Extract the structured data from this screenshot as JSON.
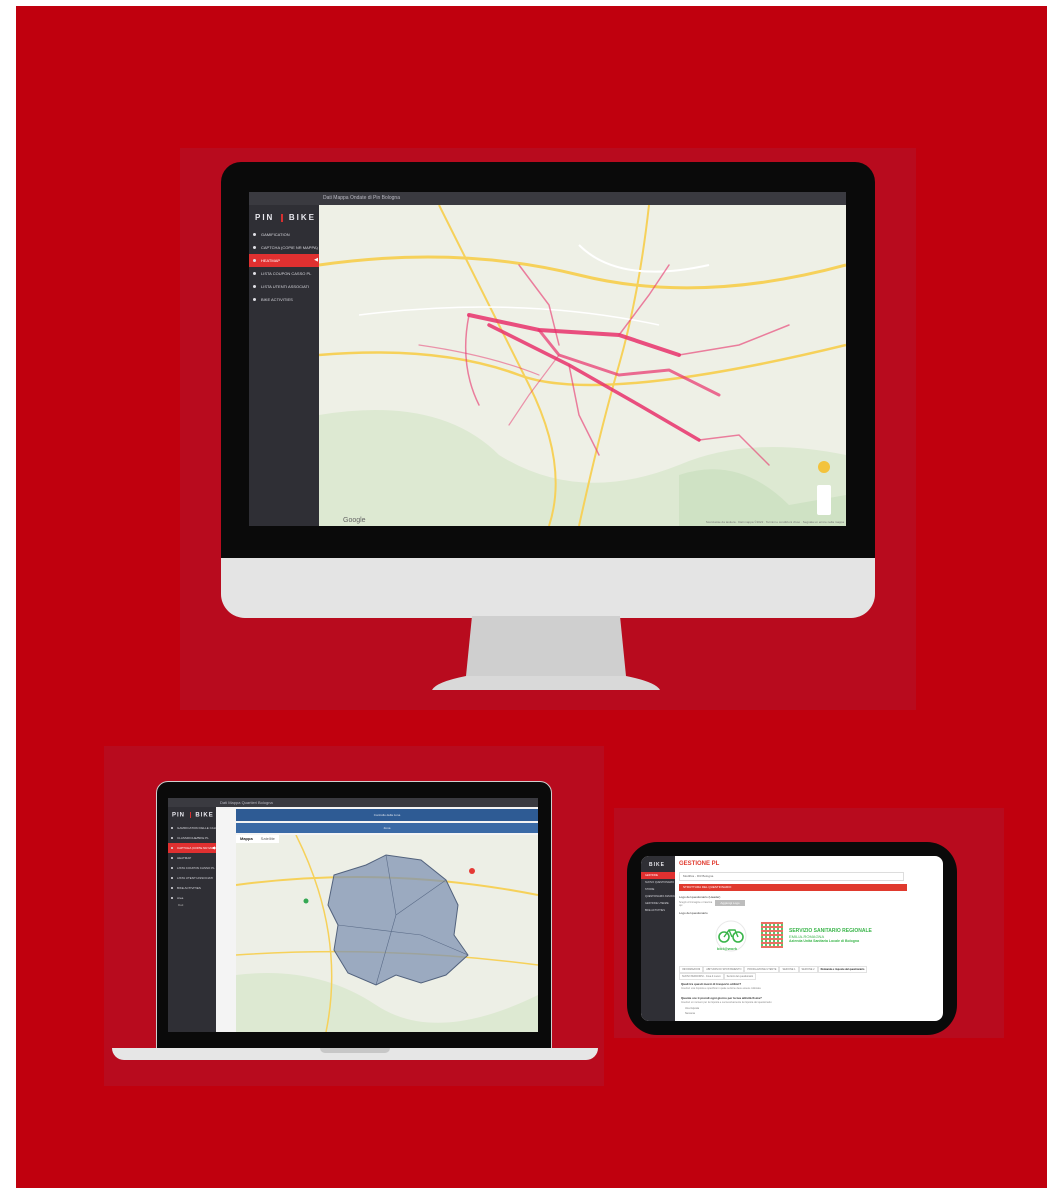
{
  "desktop": {
    "header": "Dati Mappa Ondate di Pin Bologna",
    "logo": {
      "left": "PIN",
      "right": "BIKE"
    },
    "menu": [
      {
        "label": "GAMIFICATION",
        "active": false
      },
      {
        "label": "CAPTCHA (COPIE NR MAPPA)",
        "active": false
      },
      {
        "label": "HEATMAP",
        "active": true
      },
      {
        "label": "LISTA COUPON CASSO PL",
        "active": false
      },
      {
        "label": "LISTA UTENTI ASSOCIATI",
        "active": false
      },
      {
        "label": "BIKE ACTIVITIES",
        "active": false
      }
    ],
    "map": {
      "brand": "Google",
      "attribution": "Scorciatoie da tastiera · Dati mappa ©2022 · Termini e condizioni d'uso · Segnala un errore nella mappa"
    },
    "colors": {
      "route": "#e8316b",
      "active_menu": "#e03030"
    }
  },
  "laptop": {
    "header": "Dati Mappa Quartieri Bologna",
    "logo": {
      "left": "PIN",
      "right": "BIKE"
    },
    "menu": [
      {
        "label": "GAMIFICATION DELLE CALPS",
        "active": false
      },
      {
        "label": "CLASSIFICHE/BIKE PL",
        "active": false
      },
      {
        "label": "CAPTCHA (COPIE NR MAPPA)",
        "active": true
      },
      {
        "label": "HEATMAP",
        "active": false
      },
      {
        "label": "LISTA COUPON CASSO PL",
        "active": false
      },
      {
        "label": "LISTA UTENTI ASSOCIATI",
        "active": false
      },
      {
        "label": "BIKE ACTIVITIES",
        "active": false
      },
      {
        "label": "Area",
        "active": false
      }
    ],
    "menu_sub": "Dati",
    "bar1": "Controllo della zona",
    "bar2": "Zona",
    "tabs": [
      "Mappa",
      "Satellite"
    ],
    "colors": {
      "region_fill": "#7f93b3",
      "bar": "#2e5b94"
    }
  },
  "tablet": {
    "logo": "BIKE",
    "page_title": "GESTIONE PL",
    "menu": [
      {
        "label": "GESTIONE",
        "active": true
      },
      {
        "label": "NUOVO QUESTIONARIO",
        "active": false
      },
      {
        "label": "STORIE",
        "active": false
      },
      {
        "label": "QUESTIONARIO ASSOCIATO",
        "active": false
      },
      {
        "label": "GESTIONE UTENZE",
        "active": false
      },
      {
        "label": "BIKE ACTIVITIES",
        "active": false
      }
    ],
    "select_value": "Modifica - ID3 Bologna",
    "red_bar": "STRUTTURA DEL QUESTIONARIO",
    "field1_label": "Logo del questionario (Header)",
    "field1_hint": "Scegli un'immagine o trascina qui",
    "upload_button": "Aggiungi Logo",
    "field2_label": "Logo del questionario",
    "logo_bike_text": "bici@work",
    "logo_text": [
      "SERVIZIO SANITARIO REGIONALE",
      "EMILIA-ROMAGNA",
      "Azienda Unità Sanitaria Locale di Bologna"
    ],
    "tabs": [
      "INFORMAZIONI",
      "ABITUDINI DI SPOSTAMENTO",
      "PROFILAZIONE UTENTE",
      "SEZIONE 1",
      "SEZIONE 2",
      "Domande e risposte del questionario",
      "NUOVI PERCORSI - Crea il nuovo",
      "Sezioni del questionario"
    ],
    "q1_title": "Quali tra questi mezzi di trasporto utilizzi?",
    "q1_hint": "Inserisci una risposta e specifica in quale sezione deve essere collocata",
    "q2_title": "Quante ore ti prendi ogni giorno per la tua attività fisica?",
    "q2_hint": "Inserisci un numero per la risposta e successivamente la risposta del questionario",
    "q2_options": [
      "Una risposta",
      "Nessuna"
    ],
    "colors": {
      "accent": "#e03a2e",
      "logo_green": "#3ab54a"
    }
  }
}
